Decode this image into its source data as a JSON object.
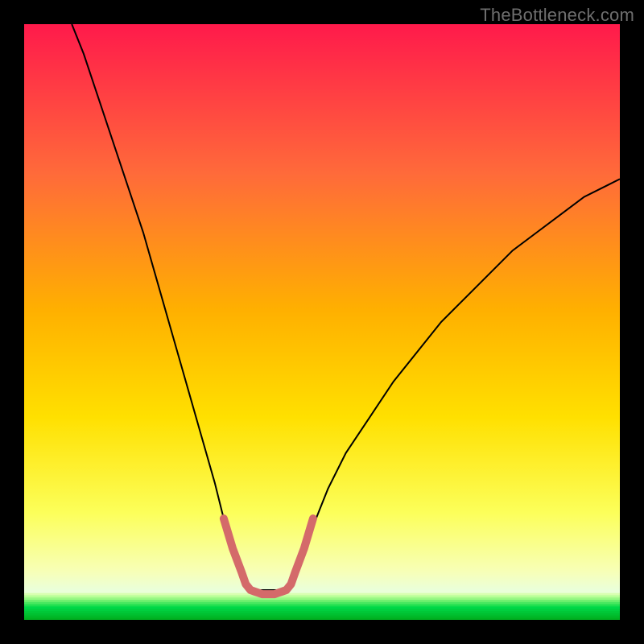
{
  "watermark": "TheBottleneck.com",
  "chart_data": {
    "type": "line",
    "title": "",
    "xlabel": "",
    "ylabel": "",
    "xlim": [
      0,
      100
    ],
    "ylim": [
      0,
      100
    ],
    "background_gradient": {
      "top": "#ff1a4b",
      "mid_upper": "#ff7a3a",
      "mid": "#ffd400",
      "mid_lower": "#f7ff66",
      "green_band": "#00e060",
      "bottom": "#00e060"
    },
    "series": [
      {
        "name": "bottleneck-curve",
        "color": "#000000",
        "stroke_width": 2,
        "x": [
          8,
          10,
          12,
          14,
          16,
          18,
          20,
          22,
          24,
          26,
          28,
          30,
          32,
          33.5,
          35,
          36.5,
          38,
          44,
          45.5,
          47,
          49,
          51,
          54,
          58,
          62,
          66,
          70,
          74,
          78,
          82,
          86,
          90,
          94,
          98,
          100
        ],
        "y": [
          100,
          95,
          89,
          83,
          77,
          71,
          65,
          58,
          51,
          44,
          37,
          30,
          23,
          17,
          12,
          8,
          5,
          5,
          8,
          12,
          17,
          22,
          28,
          34,
          40,
          45,
          50,
          54,
          58,
          62,
          65,
          68,
          71,
          73,
          74
        ]
      },
      {
        "name": "optimal-flat-marker",
        "color": "#d46a6a",
        "stroke_width": 10,
        "linecap": "round",
        "x": [
          33.5,
          35,
          36.5,
          37.2,
          38,
          40,
          42,
          44,
          44.8,
          45.5,
          47,
          48.5
        ],
        "y": [
          17,
          12,
          8,
          6,
          5,
          4.3,
          4.3,
          5,
          6,
          8,
          12,
          17
        ]
      }
    ],
    "bottom_stripes": {
      "start_y": 4.5,
      "end_y": 0,
      "count": 12,
      "colors": [
        "#d8ffb0",
        "#b8ff98",
        "#98f884",
        "#70f070",
        "#48e860",
        "#20e050",
        "#00d848",
        "#00d040",
        "#00c838",
        "#00c030",
        "#00b828",
        "#00b020"
      ]
    }
  }
}
